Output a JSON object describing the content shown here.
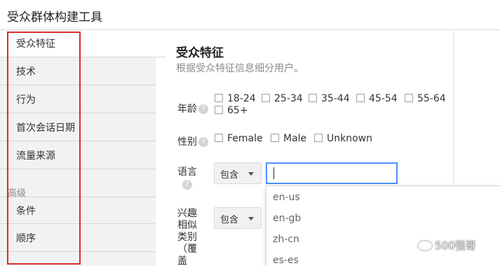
{
  "window": {
    "title": "受众群体构建工具"
  },
  "sidebar": {
    "items": [
      {
        "label": "受众特征",
        "active": true
      },
      {
        "label": "技术"
      },
      {
        "label": "行为"
      },
      {
        "label": "首次会话日期"
      },
      {
        "label": "流量来源"
      }
    ],
    "section_label": "高级",
    "advanced_items": [
      {
        "label": "条件"
      },
      {
        "label": "顺序"
      }
    ],
    "highlight_color": "#d92b2b"
  },
  "main": {
    "heading": "受众特征",
    "subtitle": "根据受众特征信息细分用户。",
    "age": {
      "label": "年龄",
      "options": [
        "18-24",
        "25-34",
        "35-44",
        "45-54",
        "55-64",
        "65+"
      ]
    },
    "gender": {
      "label": "性别",
      "options": [
        "Female",
        "Male",
        "Unknown"
      ]
    },
    "language": {
      "label": "语言",
      "operator": "包含",
      "input_value": "",
      "suggestions": [
        "en-us",
        "en-gb",
        "zh-cn",
        "es-es"
      ]
    },
    "interest": {
      "label_lines": [
        "兴趣",
        "相似",
        "类别",
        "（覆",
        "盖"
      ],
      "operator": "包含"
    },
    "help_glyph": "?"
  },
  "watermark": {
    "text": "500强哥"
  },
  "colors": {
    "focus": "#4d90fe",
    "sidebar_bg": "#f2f2f2"
  }
}
